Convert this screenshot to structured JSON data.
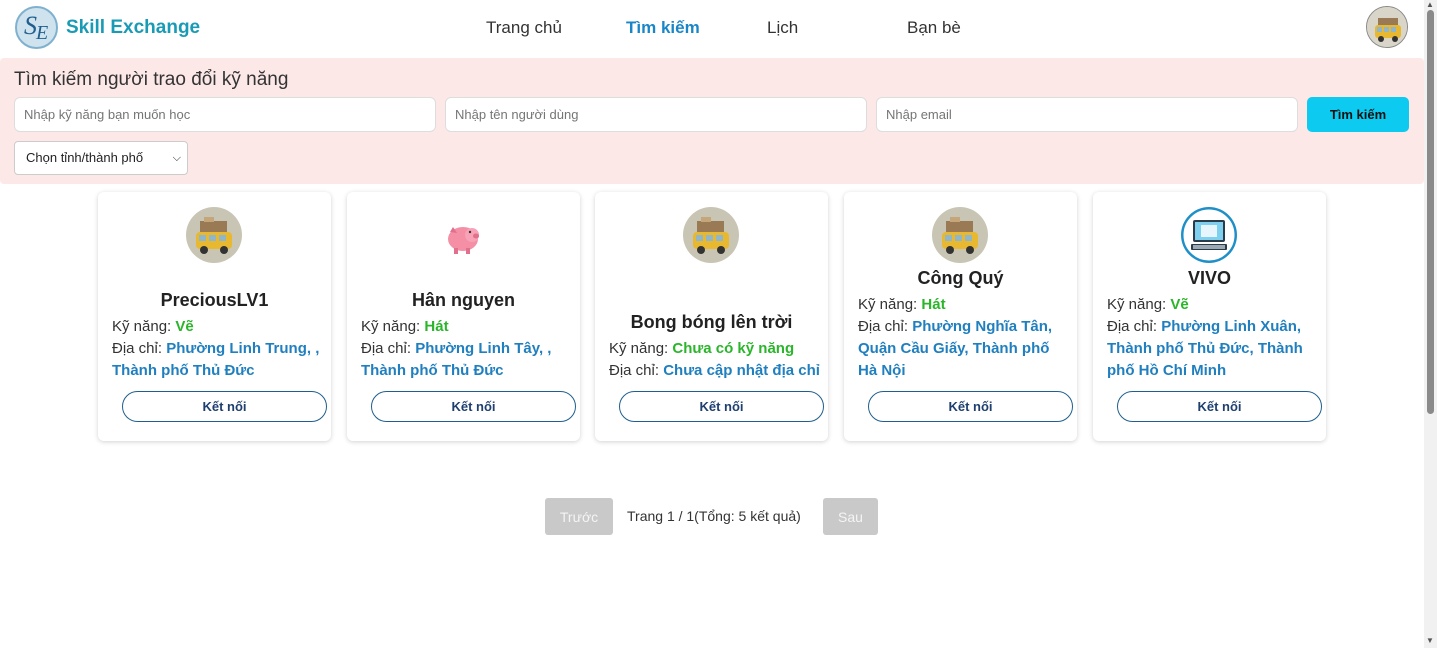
{
  "navbar": {
    "brand": "Skill Exchange",
    "logo_icon": "skill-exchange-logo",
    "links": [
      {
        "label": "Trang chủ",
        "active": false
      },
      {
        "label": "Tìm kiếm",
        "active": true
      },
      {
        "label": "Lịch",
        "active": false
      },
      {
        "label": "Bạn bè",
        "active": false
      }
    ]
  },
  "search": {
    "title": "Tìm kiếm người trao đổi kỹ năng",
    "skill_placeholder": "Nhập kỹ năng bạn muốn học",
    "username_placeholder": "Nhập tên người dùng",
    "email_placeholder": "Nhập email",
    "button_label": "Tìm kiếm",
    "city_select": "Chọn tỉnh/thành phố"
  },
  "labels": {
    "skill": "Kỹ năng:",
    "address": "Địa chỉ:",
    "connect": "Kết nối"
  },
  "users": [
    {
      "name": "PreciousLV1",
      "skill": "Vẽ",
      "address": "Phường Linh Trung, , Thành phố Thủ Đức",
      "avatar": "bus-avatar-icon"
    },
    {
      "name": "Hân nguyen",
      "skill": "Hát",
      "address": "Phường Linh Tây, , Thành phố Thủ Đức",
      "avatar": "pig-avatar-icon"
    },
    {
      "name": "Bong bóng lên trời",
      "skill": "Chưa có kỹ năng",
      "address": "Chưa cập nhật địa chỉ",
      "avatar": "bus-avatar-icon"
    },
    {
      "name": "Công Quý",
      "skill": "Hát",
      "address": "Phường Nghĩa Tân, Quận Cầu Giấy, Thành phố Hà Nội",
      "avatar": "bus-avatar-icon"
    },
    {
      "name": "VIVO",
      "skill": "Vẽ",
      "address": "Phường Linh Xuân, Thành phố Thủ Đức, Thành phố Hồ Chí Minh",
      "avatar": "computer-avatar-icon"
    }
  ],
  "pagination": {
    "prev": "Trước",
    "info": "Trang 1 / 1(Tổng: 5 kết quả)",
    "next": "Sau"
  },
  "colors": {
    "brand": "#1a9bb5",
    "active_nav": "#1a86c8",
    "search_bg": "#fde8e8",
    "search_button": "#0dcaf0",
    "skill_value": "#2bb52b",
    "address_value": "#1f7fbf"
  }
}
